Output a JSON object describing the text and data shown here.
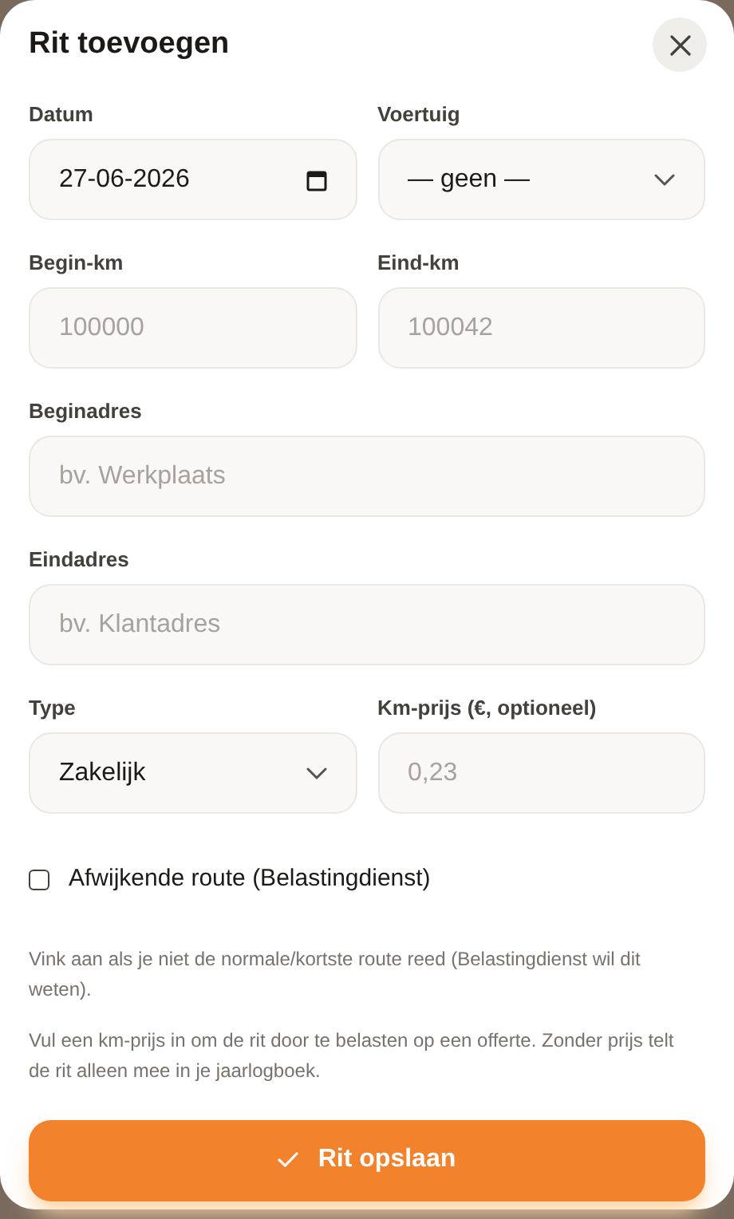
{
  "dialog": {
    "title": "Rit toevoegen"
  },
  "rows": [
    [
      {
        "label": "Datum",
        "kind": "date",
        "value": "27-06-2026"
      },
      {
        "label": "Voertuig",
        "kind": "select",
        "value": "— geen —"
      }
    ],
    [
      {
        "label": "Begin-km",
        "kind": "input",
        "placeholder": "100000"
      },
      {
        "label": "Eind-km",
        "kind": "input",
        "placeholder": "100042"
      }
    ],
    [
      {
        "label": "Beginadres",
        "kind": "input",
        "placeholder": "bv. Werkplaats"
      }
    ],
    [
      {
        "label": "Eindadres",
        "kind": "input",
        "placeholder": "bv. Klantadres"
      }
    ],
    [
      {
        "label": "Type",
        "kind": "select",
        "value": "Zakelijk"
      },
      {
        "label": "Km-prijs (€, optioneel)",
        "kind": "input",
        "placeholder": "0,23"
      }
    ]
  ],
  "checkbox": {
    "label": "Afwijkende route (Belastingdienst)",
    "checked": false
  },
  "help_texts": [
    "Vink aan als je niet de normale/kortste route reed (Belastingdienst wil dit weten).",
    "Vul een km-prijs in om de rit door te belasten op een offerte. Zonder prijs telt de rit alleen mee in je jaarlogboek."
  ],
  "submit_button": {
    "label": "Rit opslaan"
  }
}
